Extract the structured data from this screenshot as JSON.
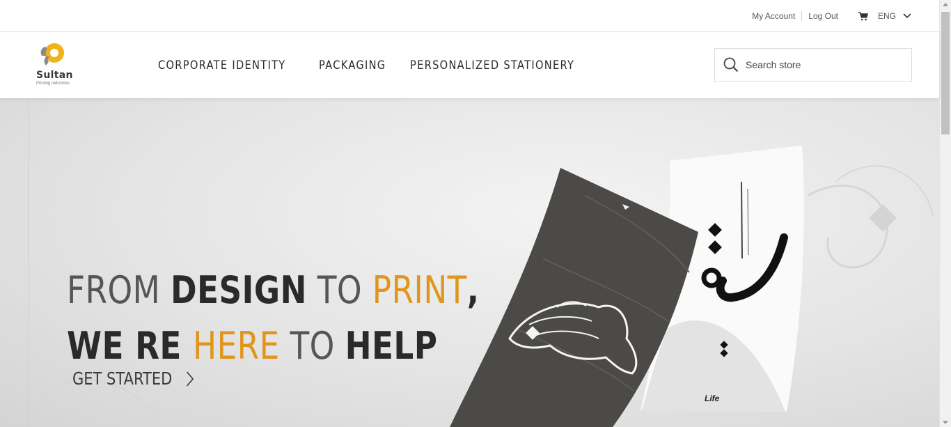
{
  "topbar": {
    "my_account": "My Account",
    "log_out": "Log Out",
    "cart_icon": "cart-icon",
    "language": "ENG",
    "language_icon": "chevron-down-icon"
  },
  "header": {
    "logo": {
      "name": "Sultan",
      "subtitle": "Printing Industries"
    },
    "nav": [
      {
        "label": "CORPORATE IDENTITY"
      },
      {
        "label": "PACKAGING"
      },
      {
        "label": "PERSONALIZED STATIONERY"
      }
    ],
    "search": {
      "placeholder": "Search store",
      "icon": "search-icon"
    }
  },
  "hero": {
    "line1": {
      "part1": "FROM ",
      "part2": "DESIGN",
      "part3": " TO ",
      "part4": "PRINT",
      "part5": ","
    },
    "line2": {
      "part1": "WE RE ",
      "part2": "HERE",
      "part3": " TO ",
      "part4": "HELP"
    },
    "cta": {
      "label": "GET STARTED",
      "icon": "chevron-right-icon"
    },
    "poster_caption": "Life"
  },
  "colors": {
    "accent": "#e0951c",
    "text_dark": "#2a2a2a",
    "logo_gray": "#8a8a8a",
    "logo_yellow": "#f2b21b"
  }
}
